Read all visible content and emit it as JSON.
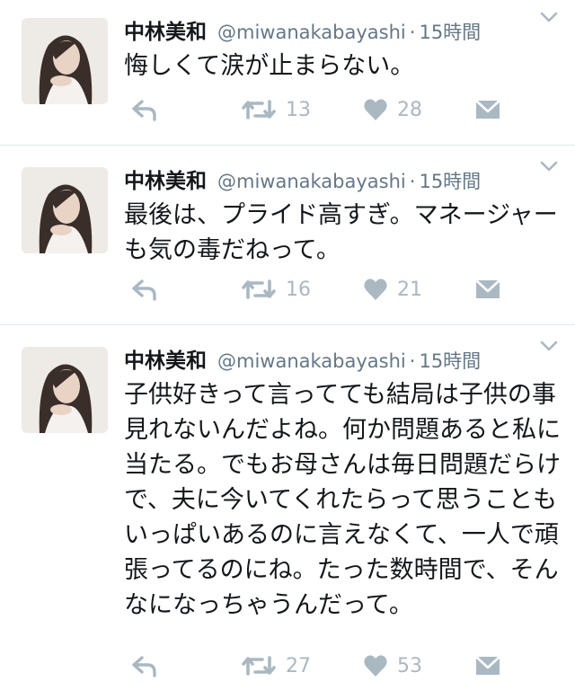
{
  "colors": {
    "text": "#14171a",
    "secondary": "#657786",
    "icon": "#aab8c2",
    "divider": "#e1e8ed"
  },
  "tweets": [
    {
      "name": "中林美和",
      "handle": "@miwanakabayashi",
      "separator": "·",
      "time": "15時間",
      "text": "悔しくて涙が止まらない。",
      "retweets": "13",
      "likes": "28"
    },
    {
      "name": "中林美和",
      "handle": "@miwanakabayashi",
      "separator": "·",
      "time": "15時間",
      "text": "最後は、プライド高すぎ。マネージャーも気の毒だねって。",
      "retweets": "16",
      "likes": "21"
    },
    {
      "name": "中林美和",
      "handle": "@miwanakabayashi",
      "separator": "·",
      "time": "15時間",
      "text": "子供好きって言ってても結局は子供の事見れないんだよね。何か問題あると私に当たる。でもお母さんは毎日問題だらけで、夫に今いてくれたらって思うこともいっぱいあるのに言えなくて、一人で頑張ってるのにね。たった数時間で、そんなになっちゃうんだって。",
      "retweets": "27",
      "likes": "53"
    }
  ],
  "icons": {
    "reply": "reply-icon",
    "retweet": "retweet-icon",
    "like": "heart-icon",
    "dm": "envelope-icon",
    "caret": "chevron-down-icon",
    "avatar": "avatar"
  }
}
